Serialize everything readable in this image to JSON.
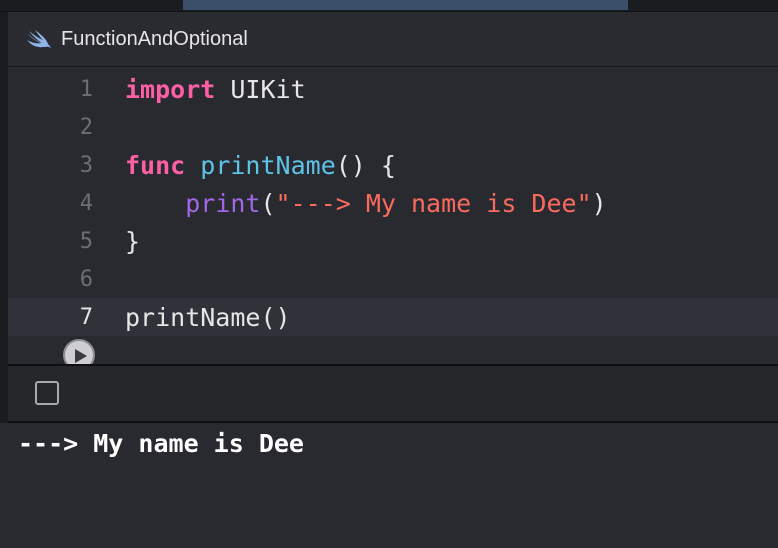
{
  "window": {
    "title": "FunctionAndOptional"
  },
  "editor": {
    "lines": [
      {
        "number": "1",
        "tokens": [
          "import",
          " UIKit"
        ]
      },
      {
        "number": "2"
      },
      {
        "number": "3",
        "tokens": [
          "func",
          " ",
          "printName",
          "() {"
        ]
      },
      {
        "number": "4",
        "tokens": [
          "    ",
          "print",
          "(",
          "\"---> My name is Dee\"",
          ")"
        ]
      },
      {
        "number": "5",
        "tokens": [
          "}"
        ]
      },
      {
        "number": "6"
      },
      {
        "number": "7",
        "tokens": [
          "printName()"
        ]
      }
    ],
    "current_line": 7
  },
  "console": {
    "output": "---> My name is Dee"
  },
  "colors": {
    "keyword": "#fc5fa3",
    "function_decl": "#5dc4e8",
    "builtin_call": "#a167e6",
    "string": "#fc6a5d",
    "plain": "#e6e6e6",
    "editor_bg": "#292a30"
  },
  "icons": {
    "file_icon": "swift-logo-icon",
    "run_button": "play-icon",
    "console_toggle": "checkbox-icon"
  }
}
